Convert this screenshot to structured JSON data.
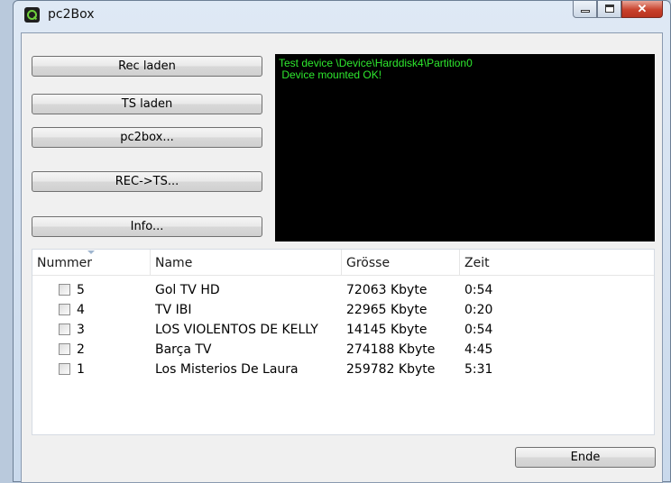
{
  "window": {
    "title": "pc2Box"
  },
  "buttons": {
    "rec_laden": "Rec laden",
    "ts_laden": "TS laden",
    "pc2box": "pc2box...",
    "rec_ts": "REC->TS...",
    "info": "Info...",
    "ende": "Ende"
  },
  "console": {
    "lines": [
      "Test device \\Device\\Harddisk4\\Partition0",
      " Device mounted OK!"
    ],
    "text_color": "#2ee82e",
    "bg_color": "#000000"
  },
  "table": {
    "columns": [
      "Nummer",
      "Name",
      "Grösse",
      "Zeit"
    ],
    "rows": [
      {
        "nummer": "5",
        "name": "Gol TV HD",
        "groesse": "72063 Kbyte",
        "zeit": "0:54",
        "checked": false
      },
      {
        "nummer": "4",
        "name": "TV IBI",
        "groesse": "22965 Kbyte",
        "zeit": "0:20",
        "checked": false
      },
      {
        "nummer": "3",
        "name": "LOS VIOLENTOS DE KELLY",
        "groesse": "14145 Kbyte",
        "zeit": "0:54",
        "checked": false
      },
      {
        "nummer": "2",
        "name": "Barça TV",
        "groesse": "274188 Kbyte",
        "zeit": "4:45",
        "checked": false
      },
      {
        "nummer": "1",
        "name": "Los Misterios De Laura",
        "groesse": "259782 Kbyte",
        "zeit": "5:31",
        "checked": false
      }
    ]
  }
}
